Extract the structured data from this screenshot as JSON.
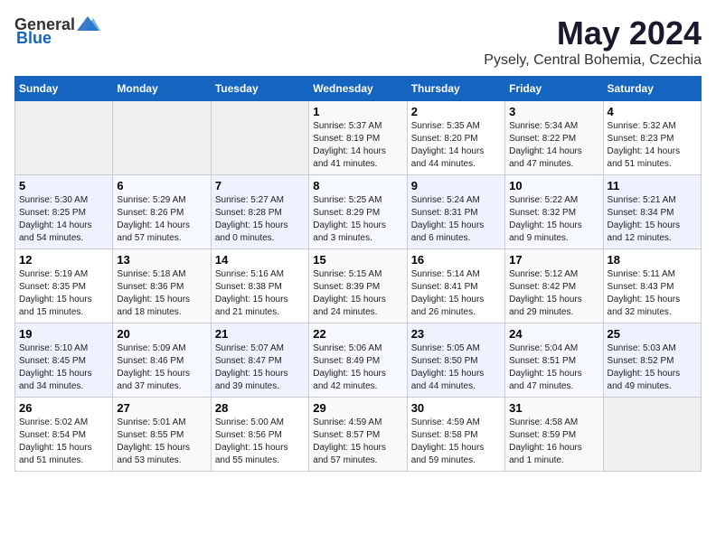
{
  "logo": {
    "general": "General",
    "blue": "Blue"
  },
  "title": "May 2024",
  "location": "Pysely, Central Bohemia, Czechia",
  "weekdays": [
    "Sunday",
    "Monday",
    "Tuesday",
    "Wednesday",
    "Thursday",
    "Friday",
    "Saturday"
  ],
  "weeks": [
    [
      {
        "day": "",
        "info": ""
      },
      {
        "day": "",
        "info": ""
      },
      {
        "day": "",
        "info": ""
      },
      {
        "day": "1",
        "info": "Sunrise: 5:37 AM\nSunset: 8:19 PM\nDaylight: 14 hours\nand 41 minutes."
      },
      {
        "day": "2",
        "info": "Sunrise: 5:35 AM\nSunset: 8:20 PM\nDaylight: 14 hours\nand 44 minutes."
      },
      {
        "day": "3",
        "info": "Sunrise: 5:34 AM\nSunset: 8:22 PM\nDaylight: 14 hours\nand 47 minutes."
      },
      {
        "day": "4",
        "info": "Sunrise: 5:32 AM\nSunset: 8:23 PM\nDaylight: 14 hours\nand 51 minutes."
      }
    ],
    [
      {
        "day": "5",
        "info": "Sunrise: 5:30 AM\nSunset: 8:25 PM\nDaylight: 14 hours\nand 54 minutes."
      },
      {
        "day": "6",
        "info": "Sunrise: 5:29 AM\nSunset: 8:26 PM\nDaylight: 14 hours\nand 57 minutes."
      },
      {
        "day": "7",
        "info": "Sunrise: 5:27 AM\nSunset: 8:28 PM\nDaylight: 15 hours\nand 0 minutes."
      },
      {
        "day": "8",
        "info": "Sunrise: 5:25 AM\nSunset: 8:29 PM\nDaylight: 15 hours\nand 3 minutes."
      },
      {
        "day": "9",
        "info": "Sunrise: 5:24 AM\nSunset: 8:31 PM\nDaylight: 15 hours\nand 6 minutes."
      },
      {
        "day": "10",
        "info": "Sunrise: 5:22 AM\nSunset: 8:32 PM\nDaylight: 15 hours\nand 9 minutes."
      },
      {
        "day": "11",
        "info": "Sunrise: 5:21 AM\nSunset: 8:34 PM\nDaylight: 15 hours\nand 12 minutes."
      }
    ],
    [
      {
        "day": "12",
        "info": "Sunrise: 5:19 AM\nSunset: 8:35 PM\nDaylight: 15 hours\nand 15 minutes."
      },
      {
        "day": "13",
        "info": "Sunrise: 5:18 AM\nSunset: 8:36 PM\nDaylight: 15 hours\nand 18 minutes."
      },
      {
        "day": "14",
        "info": "Sunrise: 5:16 AM\nSunset: 8:38 PM\nDaylight: 15 hours\nand 21 minutes."
      },
      {
        "day": "15",
        "info": "Sunrise: 5:15 AM\nSunset: 8:39 PM\nDaylight: 15 hours\nand 24 minutes."
      },
      {
        "day": "16",
        "info": "Sunrise: 5:14 AM\nSunset: 8:41 PM\nDaylight: 15 hours\nand 26 minutes."
      },
      {
        "day": "17",
        "info": "Sunrise: 5:12 AM\nSunset: 8:42 PM\nDaylight: 15 hours\nand 29 minutes."
      },
      {
        "day": "18",
        "info": "Sunrise: 5:11 AM\nSunset: 8:43 PM\nDaylight: 15 hours\nand 32 minutes."
      }
    ],
    [
      {
        "day": "19",
        "info": "Sunrise: 5:10 AM\nSunset: 8:45 PM\nDaylight: 15 hours\nand 34 minutes."
      },
      {
        "day": "20",
        "info": "Sunrise: 5:09 AM\nSunset: 8:46 PM\nDaylight: 15 hours\nand 37 minutes."
      },
      {
        "day": "21",
        "info": "Sunrise: 5:07 AM\nSunset: 8:47 PM\nDaylight: 15 hours\nand 39 minutes."
      },
      {
        "day": "22",
        "info": "Sunrise: 5:06 AM\nSunset: 8:49 PM\nDaylight: 15 hours\nand 42 minutes."
      },
      {
        "day": "23",
        "info": "Sunrise: 5:05 AM\nSunset: 8:50 PM\nDaylight: 15 hours\nand 44 minutes."
      },
      {
        "day": "24",
        "info": "Sunrise: 5:04 AM\nSunset: 8:51 PM\nDaylight: 15 hours\nand 47 minutes."
      },
      {
        "day": "25",
        "info": "Sunrise: 5:03 AM\nSunset: 8:52 PM\nDaylight: 15 hours\nand 49 minutes."
      }
    ],
    [
      {
        "day": "26",
        "info": "Sunrise: 5:02 AM\nSunset: 8:54 PM\nDaylight: 15 hours\nand 51 minutes."
      },
      {
        "day": "27",
        "info": "Sunrise: 5:01 AM\nSunset: 8:55 PM\nDaylight: 15 hours\nand 53 minutes."
      },
      {
        "day": "28",
        "info": "Sunrise: 5:00 AM\nSunset: 8:56 PM\nDaylight: 15 hours\nand 55 minutes."
      },
      {
        "day": "29",
        "info": "Sunrise: 4:59 AM\nSunset: 8:57 PM\nDaylight: 15 hours\nand 57 minutes."
      },
      {
        "day": "30",
        "info": "Sunrise: 4:59 AM\nSunset: 8:58 PM\nDaylight: 15 hours\nand 59 minutes."
      },
      {
        "day": "31",
        "info": "Sunrise: 4:58 AM\nSunset: 8:59 PM\nDaylight: 16 hours\nand 1 minute."
      },
      {
        "day": "",
        "info": ""
      }
    ]
  ]
}
